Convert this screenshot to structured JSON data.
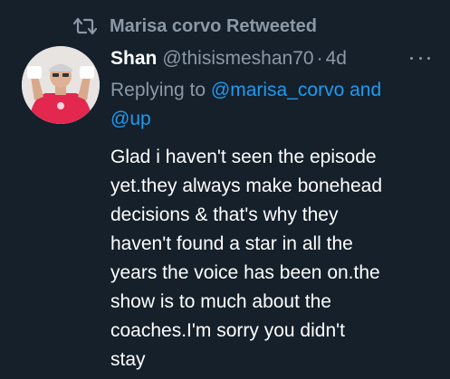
{
  "retweet": {
    "icon": "retweet-icon",
    "label": "Marisa corvo Retweeted"
  },
  "tweet": {
    "avatar_icon": "avatar",
    "display_name": "Shan",
    "handle": "@thisismeshan70",
    "separator": "·",
    "time": "4d",
    "more_icon": "more-options-icon",
    "reply": {
      "prefix": "Replying to ",
      "mention_1": "@marisa_corvo",
      "joiner": " and",
      "mention_2": "@up"
    },
    "text_lines": [
      "Glad i haven't seen the episode",
      "yet.they always make bonehead",
      "decisions & that's why they",
      "haven't found a star in all the",
      "years the voice has been on.the",
      "show is to much about the",
      "coaches.I'm sorry you didn't",
      "stay"
    ]
  },
  "colors": {
    "background": "#15202b",
    "secondary_text": "#8b98a5",
    "link": "#1d9bf0",
    "primary_text": "#ffffff"
  }
}
